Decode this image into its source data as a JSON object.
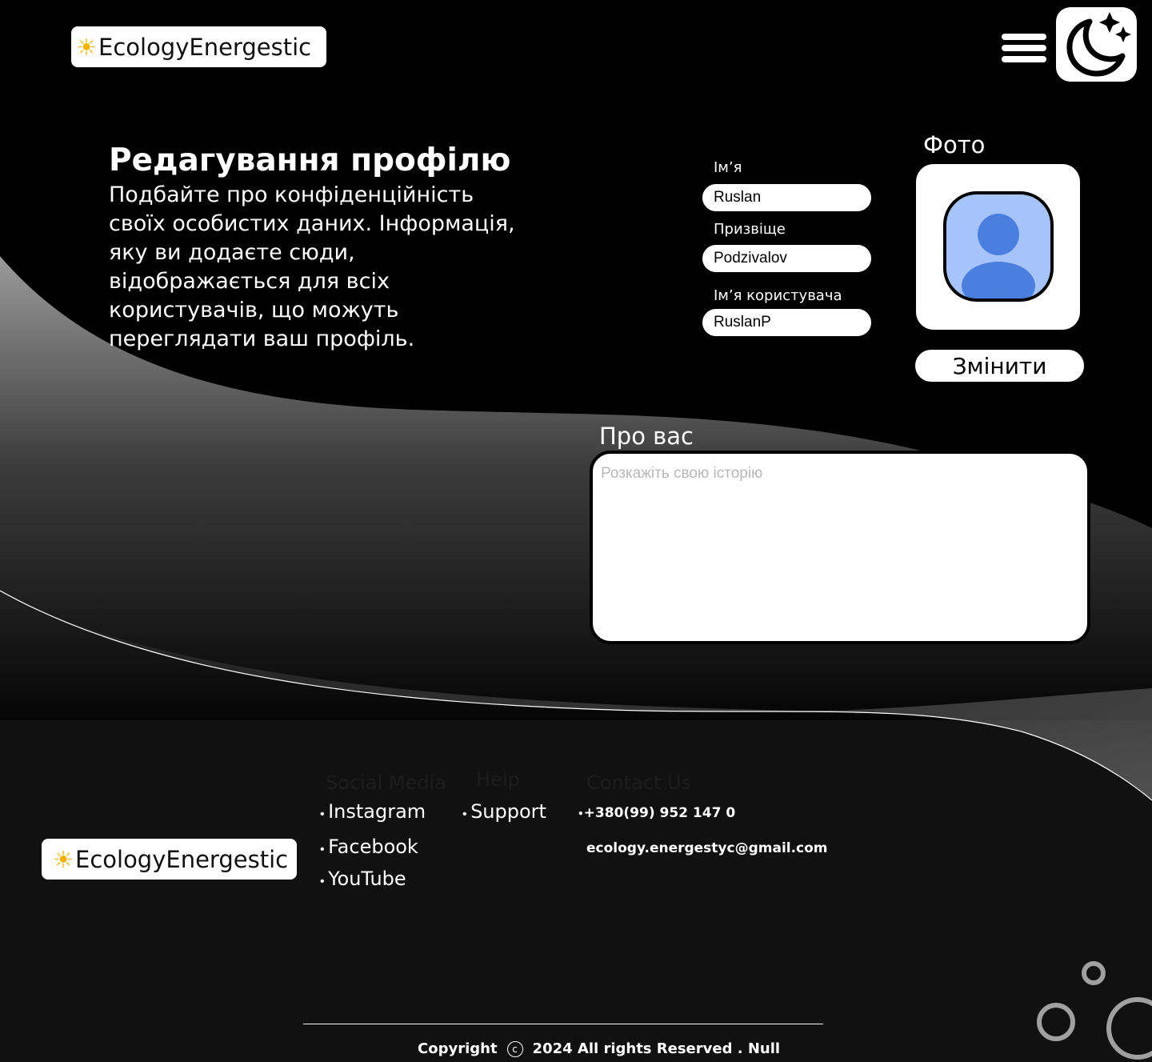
{
  "brand": {
    "name": "EcologyEnergestic",
    "sun_glyph": "☀"
  },
  "header": {
    "menu_icon": "hamburger-menu-icon",
    "theme_icon": "moon-stars-icon"
  },
  "intro": {
    "title": "Редагування профілю",
    "description": "Подбайте про конфіденційність своїх особистих даних. Інформація, яку ви додаєте сюди, відображається для всіх користувачів, що можуть переглядати ваш профіль."
  },
  "form": {
    "first_name": {
      "label": "Ім’я",
      "value": "Ruslan"
    },
    "last_name": {
      "label": "Призвіще",
      "value": "Podzivalov"
    },
    "username": {
      "label": "Ім’я користувача",
      "value": "RuslanP"
    }
  },
  "photo": {
    "label": "Фото",
    "change_label": "Змінити",
    "avatar_icon": "user-avatar-icon"
  },
  "about": {
    "label": "Про вас",
    "placeholder": "Розкажіть свою історію",
    "value": ""
  },
  "footer": {
    "social": {
      "heading": "Social Media",
      "links": [
        "Instagram",
        "Facebook",
        "YouTube"
      ]
    },
    "help": {
      "heading": "Help",
      "links": [
        "Support"
      ]
    },
    "contact": {
      "heading": "Contact Us",
      "phone": "+380(99) 952 147 0",
      "email": "ecology.energestyc@gmail.com"
    },
    "copyright": {
      "prefix": "Copyright",
      "symbol": "c",
      "text": "2024 All rights Reserved . Null"
    }
  },
  "colors": {
    "page_bg": "#111111",
    "header_bg": "#000000",
    "sun": "#f5b400",
    "avatar_light": "#a7c4fa",
    "avatar_dark": "#4a7fe0"
  }
}
